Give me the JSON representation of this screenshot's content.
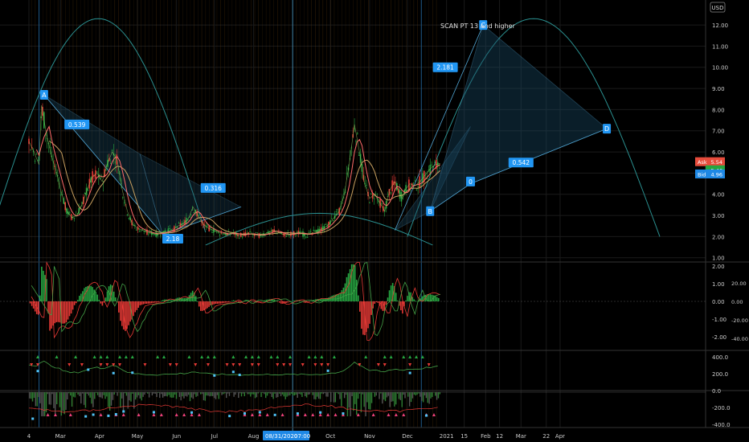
{
  "chart_data": {
    "type": "line",
    "annotation": "SCAN PT 13 and higher",
    "currency": "USD",
    "price_axis": {
      "range": [
        0.8,
        12.8
      ],
      "ticks": [
        {
          "v": 12,
          "t": "12.00"
        },
        {
          "v": 11,
          "t": "11.00"
        },
        {
          "v": 10,
          "t": "10.00"
        },
        {
          "v": 9,
          "t": "9.00"
        },
        {
          "v": 8,
          "t": "8.00"
        },
        {
          "v": 7,
          "t": "7.00"
        },
        {
          "v": 6,
          "t": "6.00"
        },
        {
          "v": 5,
          "t": "5.00"
        },
        {
          "v": 4,
          "t": "4.00"
        },
        {
          "v": 3,
          "t": "3.00"
        },
        {
          "v": 2,
          "t": "2.00"
        },
        {
          "v": 1,
          "t": "1.00"
        }
      ]
    },
    "price_labels": [
      {
        "name": "Ask",
        "value": "5.54",
        "color": "#e74c3c"
      },
      {
        "name": "",
        "value": "5.46",
        "color": "#26a641"
      },
      {
        "name": "Bid",
        "value": "4.96",
        "color": "#1e88e5"
      }
    ],
    "time_axis": [
      {
        "t": "4",
        "d": 0
      },
      {
        "t": "Mar",
        "d": 25
      },
      {
        "t": "Apr",
        "d": 56
      },
      {
        "t": "May",
        "d": 86
      },
      {
        "t": "Jun",
        "d": 117
      },
      {
        "t": "Jul",
        "d": 147
      },
      {
        "t": "Aug",
        "d": 178
      },
      {
        "t": "Oct",
        "d": 239
      },
      {
        "t": "Nov",
        "d": 270
      },
      {
        "t": "Dec",
        "d": 300
      },
      {
        "t": "2021",
        "d": 331
      },
      {
        "t": "15",
        "d": 345
      },
      {
        "t": "Feb",
        "d": 362
      },
      {
        "t": "12",
        "d": 373
      },
      {
        "t": "Mar",
        "d": 390
      },
      {
        "t": "22",
        "d": 410
      },
      {
        "t": "Apr",
        "d": 421
      }
    ],
    "crosshair_date": "08/31/2020",
    "crosshair_time": "07:00",
    "crosshair_day": 209,
    "close_series": {
      "d": [
        0,
        4,
        8,
        10,
        14,
        18,
        22,
        26,
        30,
        34,
        38,
        42,
        46,
        50,
        54,
        58,
        62,
        66,
        70,
        74,
        78,
        82,
        86,
        90,
        94,
        98,
        102,
        106,
        110,
        114,
        118,
        122,
        126,
        130,
        134,
        138,
        142,
        146,
        150,
        154,
        158,
        162,
        166,
        170,
        174,
        178,
        182,
        186,
        190,
        194,
        198,
        202,
        206,
        210,
        214,
        218,
        222,
        226,
        230,
        234,
        238,
        242,
        246,
        250,
        254,
        258,
        262,
        266,
        270,
        274,
        278,
        282,
        286,
        290,
        294,
        296,
        298,
        302,
        306,
        310,
        314,
        318,
        322,
        326
      ],
      "v": [
        6.5,
        6.0,
        5.4,
        8.2,
        6.8,
        5.8,
        5.0,
        4.0,
        3.2,
        2.9,
        3.0,
        3.5,
        4.2,
        4.8,
        5.0,
        4.6,
        5.4,
        6.0,
        5.6,
        4.2,
        3.2,
        2.6,
        2.4,
        2.3,
        2.2,
        2.15,
        2.1,
        2.2,
        2.25,
        2.3,
        2.5,
        2.6,
        2.8,
        3.4,
        3.0,
        2.6,
        2.4,
        2.3,
        2.2,
        2.15,
        2.1,
        2.2,
        2.05,
        2.1,
        2.15,
        2.1,
        2.05,
        2.1,
        2.2,
        2.3,
        2.2,
        2.1,
        2.1,
        2.15,
        2.2,
        2.1,
        2.1,
        2.2,
        2.3,
        2.4,
        2.6,
        2.9,
        3.2,
        4.0,
        5.5,
        7.3,
        6.0,
        4.5,
        3.8,
        4.0,
        3.6,
        3.2,
        4.2,
        4.6,
        4.0,
        3.8,
        4.2,
        4.5,
        4.4,
        4.6,
        4.9,
        5.2,
        5.4,
        5.46
      ]
    },
    "pattern_points": [
      {
        "label": "A",
        "d": 12,
        "v": 8.7
      },
      {
        "label": "",
        "d": 88,
        "v": 5.9
      },
      {
        "label": "",
        "d": 106,
        "v": 2.1
      },
      {
        "label": "",
        "d": 168,
        "v": 3.4
      },
      {
        "label": "",
        "d": 290,
        "v": 2.3
      },
      {
        "label": "",
        "d": 350,
        "v": 7.2
      },
      {
        "label": "B",
        "d": 318,
        "v": 3.2
      },
      {
        "label": "C",
        "d": 360,
        "v": 12.0
      },
      {
        "label": "D",
        "d": 458,
        "v": 7.1
      },
      {
        "label": "",
        "d": 350,
        "v": 4.5
      }
    ],
    "ratio_labels": [
      {
        "t": "0.539",
        "d": 38,
        "v": 7.3
      },
      {
        "t": "0.316",
        "d": 146,
        "v": 4.3
      },
      {
        "t": "2.18",
        "d": 114,
        "v": 1.9
      },
      {
        "t": "2.181",
        "d": 330,
        "v": 10.0
      },
      {
        "t": "0.542",
        "d": 390,
        "v": 5.5
      },
      {
        "t": "0",
        "d": 350,
        "v": 4.6
      }
    ],
    "oscillator_axis": [
      {
        "v": 2,
        "t": "2.00"
      },
      {
        "v": 1,
        "t": "1.00"
      },
      {
        "v": 0,
        "t": "0.00"
      },
      {
        "v": -1,
        "t": "-1.00"
      },
      {
        "v": -2,
        "t": "-2.00"
      }
    ],
    "oscillator_axis2": [
      {
        "v": 20,
        "t": "20.00"
      },
      {
        "v": 0,
        "t": "0.00"
      },
      {
        "v": -20,
        "t": "-20.00"
      },
      {
        "v": -40,
        "t": "-40.00"
      }
    ],
    "volume_axis": [
      {
        "v": 400,
        "t": "400.0"
      },
      {
        "v": 200,
        "t": "200.0"
      },
      {
        "v": 0,
        "t": "0.0"
      },
      {
        "v": -200,
        "t": "-200.0"
      },
      {
        "v": -400,
        "t": "-400.0"
      }
    ],
    "colors": {
      "up": "#26a641",
      "down": "#e53935",
      "pattern": "#4fa3d1",
      "fill": "#1b4b66",
      "curve": "#2a8f8f",
      "axis": "#cccccc"
    }
  }
}
